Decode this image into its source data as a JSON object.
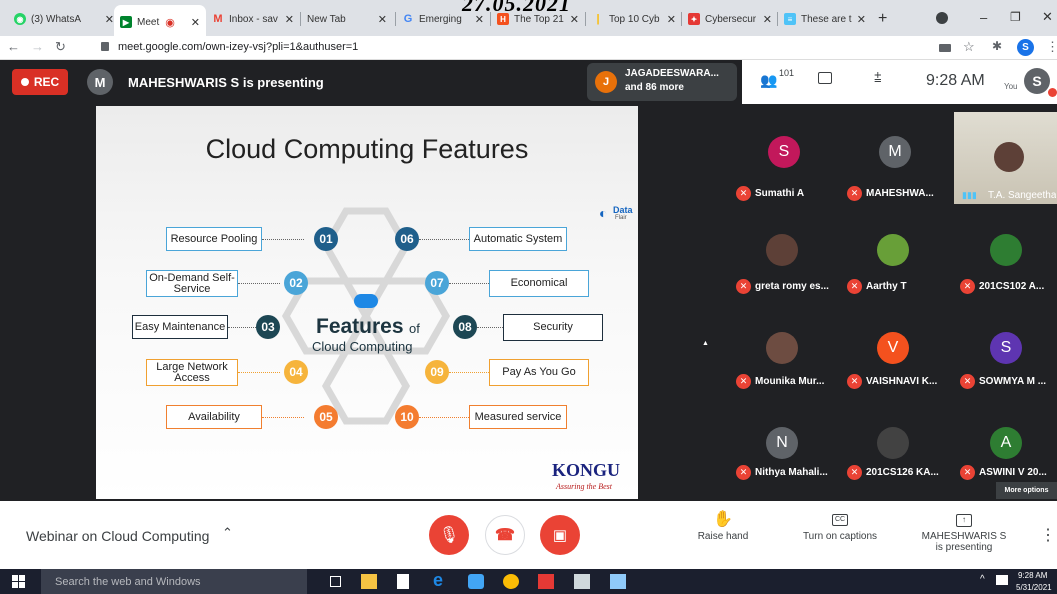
{
  "overlay_date": "27.05.2021",
  "browser": {
    "tabs": [
      {
        "label": "(3) WhatsA",
        "color": "#25d366"
      },
      {
        "label": "Meet",
        "color": "#00832d"
      },
      {
        "label": "Inbox - sav",
        "color": "#ea4335"
      },
      {
        "label": "New Tab",
        "color": "#5f6368"
      },
      {
        "label": "Emerging",
        "color": "#4285f4"
      },
      {
        "label": "The Top 21",
        "color": "#f4511e"
      },
      {
        "label": "Top 10 Cyb",
        "color": "#fbbc05"
      },
      {
        "label": "Cybersecur",
        "color": "#e53935"
      },
      {
        "label": "These are t",
        "color": "#4fc3f7"
      }
    ],
    "new_tab_symbol": "+",
    "url": "meet.google.com/own-izey-vsj?pli=1&authuser=1",
    "profile_initial": "S"
  },
  "meet": {
    "rec_label": "REC",
    "presenter_initial": "M",
    "presenting_text": "MAHESHWARIS S is presenting",
    "join_initial": "J",
    "join_name": "JAGADEESWARA...",
    "join_more": "and 86 more",
    "participant_count": "101",
    "time": "9:28 AM",
    "you_label": "You",
    "self_initial": "S"
  },
  "slide": {
    "title": "Cloud Computing Features",
    "brand": "Data",
    "brand_sub": "Flair",
    "center_big": "Features",
    "center_of": "of",
    "center_sub": "Cloud Computing",
    "logo": "KONGU",
    "logo_tagline": "Assuring the Best",
    "features": [
      {
        "num": "01",
        "label": "Resource Pooling"
      },
      {
        "num": "02",
        "label": "On-Demand Self-Service"
      },
      {
        "num": "03",
        "label": "Easy Maintenance"
      },
      {
        "num": "04",
        "label": "Large Network Access"
      },
      {
        "num": "05",
        "label": "Availability"
      },
      {
        "num": "06",
        "label": "Automatic System"
      },
      {
        "num": "07",
        "label": "Economical"
      },
      {
        "num": "08",
        "label": "Security"
      },
      {
        "num": "09",
        "label": "Pay As You Go"
      },
      {
        "num": "10",
        "label": "Measured service"
      }
    ]
  },
  "participants": [
    {
      "initial": "S",
      "name": "Sumathi A",
      "color": "#c2185b"
    },
    {
      "initial": "M",
      "name": "MAHESHWA...",
      "color": "#5f6368"
    },
    {
      "initial": "",
      "name": "T.A. Sangeetha",
      "color": ""
    },
    {
      "initial": "",
      "name": "greta romy es...",
      "color": "#5d4037"
    },
    {
      "initial": "",
      "name": "Aarthy T",
      "color": "#689f38"
    },
    {
      "initial": "",
      "name": "201CS102 A...",
      "color": "#2e7d32"
    },
    {
      "initial": "",
      "name": "Mounika Mur...",
      "color": "#6d4c41"
    },
    {
      "initial": "V",
      "name": "VAISHNAVI K...",
      "color": "#f4511e"
    },
    {
      "initial": "S",
      "name": "SOWMYA M ...",
      "color": "#5e35b1"
    },
    {
      "initial": "N",
      "name": "Nithya Mahali...",
      "color": "#5f6368"
    },
    {
      "initial": "",
      "name": "201CS126 KA...",
      "color": "#424242"
    },
    {
      "initial": "A",
      "name": "ASWINI V 20...",
      "color": "#2e7d32"
    }
  ],
  "more_options": "More options",
  "bottom": {
    "meeting_title": "Webinar on Cloud Computing",
    "raise_hand": "Raise hand",
    "captions": "Turn on captions",
    "presenter_name": "MAHESHWARIS S",
    "presenter_status": "is presenting"
  },
  "taskbar": {
    "search_placeholder": "Search the web and Windows",
    "time": "9:28 AM",
    "date": "5/31/2021"
  }
}
